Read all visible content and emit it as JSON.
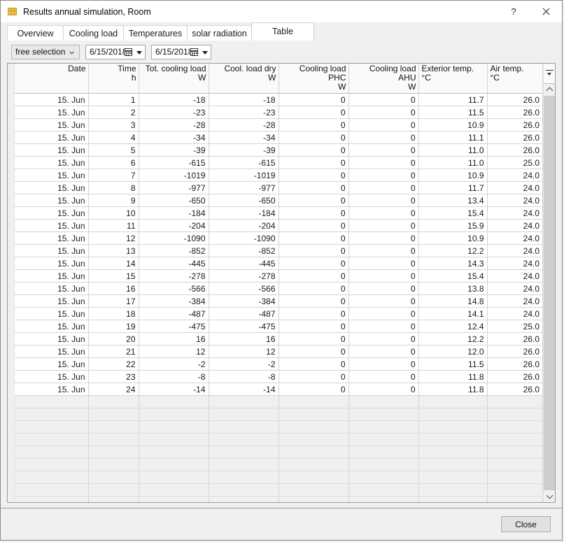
{
  "window": {
    "title": "Results annual simulation, Room",
    "icon": "table-icon",
    "help_label": "?",
    "close_label": "close-icon"
  },
  "tabs": [
    {
      "label": "Overview",
      "active": false
    },
    {
      "label": "Cooling load",
      "active": false
    },
    {
      "label": "Temperatures",
      "active": false
    },
    {
      "label": "solar radiation",
      "active": false
    },
    {
      "label": "Table",
      "active": true
    }
  ],
  "toolbar": {
    "selection_mode": "free selection",
    "date_from": "6/15/2018",
    "date_to": "6/15/2018"
  },
  "colors": {
    "highlight_red": "#f7acac",
    "highlight_blue": "#aaaaf4",
    "header_bg": "#fafafa",
    "empty_row_bg": "#f0f0f0"
  },
  "table": {
    "columns": [
      {
        "title": "Date",
        "unit": "",
        "align": "right"
      },
      {
        "title": "Time",
        "unit": "h",
        "align": "right"
      },
      {
        "title": "Tot. cooling load",
        "unit": "W",
        "align": "right"
      },
      {
        "title": "Cool. load dry",
        "unit": "W",
        "align": "right"
      },
      {
        "title": "Cooling load PHC",
        "unit": "W",
        "align": "right"
      },
      {
        "title": "Cooling load AHU",
        "unit": "W",
        "align": "right"
      },
      {
        "title": "Exterior temp.",
        "unit": "°C",
        "align": "left"
      },
      {
        "title": "Air temp.",
        "unit": "°C",
        "align": "left"
      }
    ],
    "rows": [
      {
        "cells": [
          "15. Jun",
          "1",
          "-18",
          "-18",
          "0",
          "0",
          "11.7",
          "26.0"
        ],
        "hl": {
          "7": "red"
        }
      },
      {
        "cells": [
          "15. Jun",
          "2",
          "-23",
          "-23",
          "0",
          "0",
          "11.5",
          "26.0"
        ],
        "hl": {}
      },
      {
        "cells": [
          "15. Jun",
          "3",
          "-28",
          "-28",
          "0",
          "0",
          "10.9",
          "26.0"
        ],
        "hl": {
          "6": "blue"
        }
      },
      {
        "cells": [
          "15. Jun",
          "4",
          "-34",
          "-34",
          "0",
          "0",
          "11.1",
          "26.0"
        ],
        "hl": {}
      },
      {
        "cells": [
          "15. Jun",
          "5",
          "-39",
          "-39",
          "0",
          "0",
          "11.0",
          "26.0"
        ],
        "hl": {}
      },
      {
        "cells": [
          "15. Jun",
          "6",
          "-615",
          "-615",
          "0",
          "0",
          "11.0",
          "25.0"
        ],
        "hl": {}
      },
      {
        "cells": [
          "15. Jun",
          "7",
          "-1019",
          "-1019",
          "0",
          "0",
          "10.9",
          "24.0"
        ],
        "hl": {
          "7": "blue"
        }
      },
      {
        "cells": [
          "15. Jun",
          "8",
          "-977",
          "-977",
          "0",
          "0",
          "11.7",
          "24.0"
        ],
        "hl": {}
      },
      {
        "cells": [
          "15. Jun",
          "9",
          "-650",
          "-650",
          "0",
          "0",
          "13.4",
          "24.0"
        ],
        "hl": {}
      },
      {
        "cells": [
          "15. Jun",
          "10",
          "-184",
          "-184",
          "0",
          "0",
          "15.4",
          "24.0"
        ],
        "hl": {}
      },
      {
        "cells": [
          "15. Jun",
          "11",
          "-204",
          "-204",
          "0",
          "0",
          "15.9",
          "24.0"
        ],
        "hl": {
          "6": "red"
        }
      },
      {
        "cells": [
          "15. Jun",
          "12",
          "-1090",
          "-1090",
          "0",
          "0",
          "10.9",
          "24.0"
        ],
        "hl": {
          "2": "blue",
          "3": "blue"
        }
      },
      {
        "cells": [
          "15. Jun",
          "13",
          "-852",
          "-852",
          "0",
          "0",
          "12.2",
          "24.0"
        ],
        "hl": {}
      },
      {
        "cells": [
          "15. Jun",
          "14",
          "-445",
          "-445",
          "0",
          "0",
          "14.3",
          "24.0"
        ],
        "hl": {}
      },
      {
        "cells": [
          "15. Jun",
          "15",
          "-278",
          "-278",
          "0",
          "0",
          "15.4",
          "24.0"
        ],
        "hl": {}
      },
      {
        "cells": [
          "15. Jun",
          "16",
          "-566",
          "-566",
          "0",
          "0",
          "13.8",
          "24.0"
        ],
        "hl": {}
      },
      {
        "cells": [
          "15. Jun",
          "17",
          "-384",
          "-384",
          "0",
          "0",
          "14.8",
          "24.0"
        ],
        "hl": {}
      },
      {
        "cells": [
          "15. Jun",
          "18",
          "-487",
          "-487",
          "0",
          "0",
          "14.1",
          "24.0"
        ],
        "hl": {}
      },
      {
        "cells": [
          "15. Jun",
          "19",
          "-475",
          "-475",
          "0",
          "0",
          "12.4",
          "25.0"
        ],
        "hl": {}
      },
      {
        "cells": [
          "15. Jun",
          "20",
          "16",
          "16",
          "0",
          "0",
          "12.2",
          "26.0"
        ],
        "hl": {
          "2": "red",
          "3": "red"
        }
      },
      {
        "cells": [
          "15. Jun",
          "21",
          "12",
          "12",
          "0",
          "0",
          "12.0",
          "26.0"
        ],
        "hl": {}
      },
      {
        "cells": [
          "15. Jun",
          "22",
          "-2",
          "-2",
          "0",
          "0",
          "11.5",
          "26.0"
        ],
        "hl": {}
      },
      {
        "cells": [
          "15. Jun",
          "23",
          "-8",
          "-8",
          "0",
          "0",
          "11.8",
          "26.0"
        ],
        "hl": {}
      },
      {
        "cells": [
          "15. Jun",
          "24",
          "-14",
          "-14",
          "0",
          "0",
          "11.8",
          "26.0"
        ],
        "hl": {}
      }
    ],
    "empty_row_count": 9,
    "column_menu_icon": "column-chooser-icon"
  },
  "footer": {
    "close_label": "Close"
  },
  "chart_data": {
    "type": "table",
    "title": "Results annual simulation, Room - Table",
    "categories": [
      "1",
      "2",
      "3",
      "4",
      "5",
      "6",
      "7",
      "8",
      "9",
      "10",
      "11",
      "12",
      "13",
      "14",
      "15",
      "16",
      "17",
      "18",
      "19",
      "20",
      "21",
      "22",
      "23",
      "24"
    ],
    "xlabel": "Time h",
    "series": [
      {
        "name": "Tot. cooling load W",
        "values": [
          -18,
          -23,
          -28,
          -34,
          -39,
          -615,
          -1019,
          -977,
          -650,
          -184,
          -204,
          -1090,
          -852,
          -445,
          -278,
          -566,
          -384,
          -487,
          -475,
          16,
          12,
          -2,
          -8,
          -14
        ]
      },
      {
        "name": "Cool. load dry W",
        "values": [
          -18,
          -23,
          -28,
          -34,
          -39,
          -615,
          -1019,
          -977,
          -650,
          -184,
          -204,
          -1090,
          -852,
          -445,
          -278,
          -566,
          -384,
          -487,
          -475,
          16,
          12,
          -2,
          -8,
          -14
        ]
      },
      {
        "name": "Cooling load PHC W",
        "values": [
          0,
          0,
          0,
          0,
          0,
          0,
          0,
          0,
          0,
          0,
          0,
          0,
          0,
          0,
          0,
          0,
          0,
          0,
          0,
          0,
          0,
          0,
          0,
          0
        ]
      },
      {
        "name": "Cooling load AHU W",
        "values": [
          0,
          0,
          0,
          0,
          0,
          0,
          0,
          0,
          0,
          0,
          0,
          0,
          0,
          0,
          0,
          0,
          0,
          0,
          0,
          0,
          0,
          0,
          0,
          0
        ]
      },
      {
        "name": "Exterior temp. °C",
        "values": [
          11.7,
          11.5,
          10.9,
          11.1,
          11.0,
          11.0,
          10.9,
          11.7,
          13.4,
          15.4,
          15.9,
          10.9,
          12.2,
          14.3,
          15.4,
          13.8,
          14.8,
          14.1,
          12.4,
          12.2,
          12.0,
          11.5,
          11.8,
          11.8
        ]
      },
      {
        "name": "Air temp. °C",
        "values": [
          26.0,
          26.0,
          26.0,
          26.0,
          26.0,
          25.0,
          24.0,
          24.0,
          24.0,
          24.0,
          24.0,
          24.0,
          24.0,
          24.0,
          24.0,
          24.0,
          24.0,
          24.0,
          25.0,
          26.0,
          26.0,
          26.0,
          26.0,
          26.0
        ]
      }
    ]
  }
}
